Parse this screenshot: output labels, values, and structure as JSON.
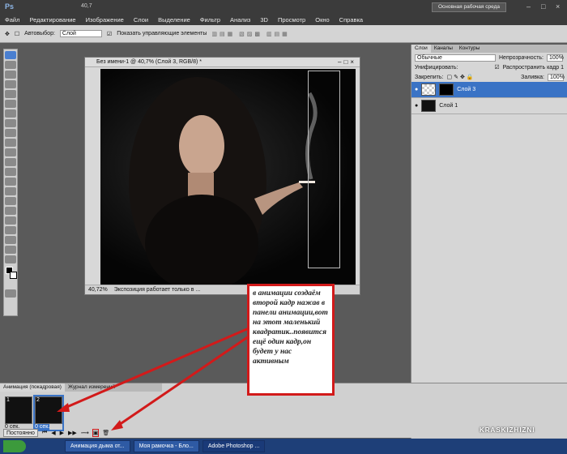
{
  "app": {
    "logo": "Ps",
    "zoom": "40,7",
    "workspace_button": "Основная рабочая среда"
  },
  "menu": [
    "Файл",
    "Редактирование",
    "Изображение",
    "Слои",
    "Выделение",
    "Фильтр",
    "Анализ",
    "3D",
    "Просмотр",
    "Окно",
    "Справка"
  ],
  "options": {
    "autoselect_label": "Автовыбор:",
    "autoselect_value": "Слой",
    "show_controls_label": "Показать управляющие элементы"
  },
  "document": {
    "title": "Без имени-1 @ 40,7% (Слой 3, RGB/8) *",
    "zoom": "40,72%",
    "status": "Экспозиция работает только в ..."
  },
  "layers_panel": {
    "tabs": [
      "Слои",
      "Каналы",
      "Контуры"
    ],
    "blend_mode": "Обычные",
    "opacity_label": "Непрозрачность:",
    "opacity": "100%",
    "unify_label": "Унифицировать:",
    "propagate_label": "Распространить кадр 1",
    "lock_label": "Закрепить:",
    "fill_label": "Заливка:",
    "fill": "100%",
    "layers": [
      {
        "name": "Слой 3",
        "selected": true
      },
      {
        "name": "Слой 1",
        "selected": false
      }
    ]
  },
  "animation_panel": {
    "tabs": [
      "Анимация (покадровая)",
      "Журнал измерений"
    ],
    "frames": [
      {
        "index": "1",
        "delay": "0 сек."
      },
      {
        "index": "2",
        "delay": "0 сек."
      }
    ],
    "loop": "Постоянно"
  },
  "callout": {
    "text": "в анимации создаём второй кадр нажав в панели анимации,вот на этот маленький квадратик..появится ещё один кадр,он будет у нас активным"
  },
  "taskbar": {
    "items": [
      "Анимация дыма от...",
      "Моя рамочка - Бло...",
      "Adobe Photoshop ..."
    ]
  },
  "watermark": "KRASKIZHIZNI",
  "colors": {
    "accent": "#3a73c5",
    "callout_border": "#d21a1a"
  }
}
